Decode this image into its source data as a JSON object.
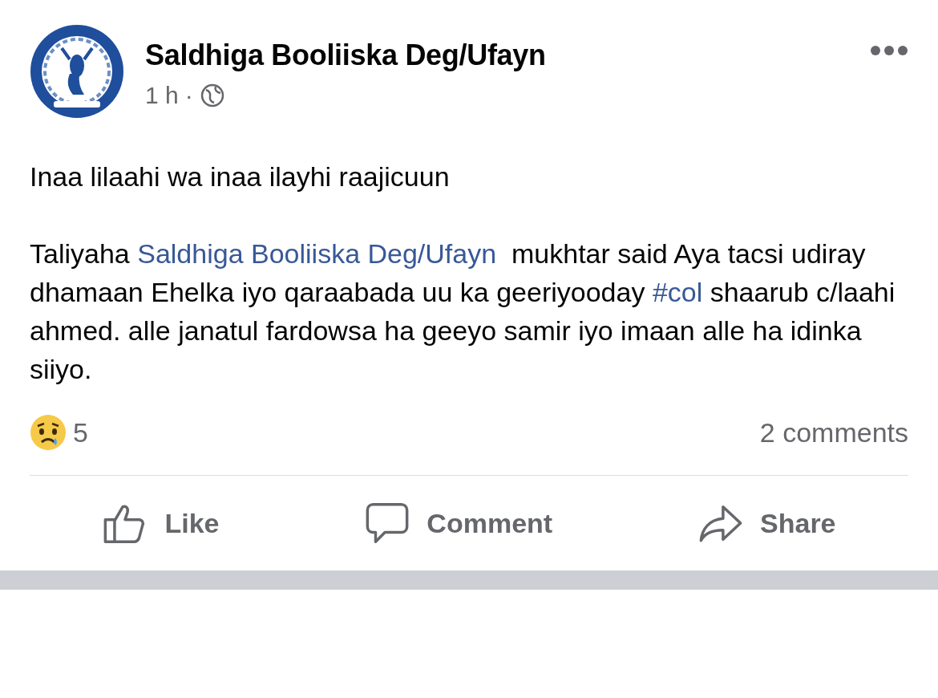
{
  "post": {
    "author": "Saldhiga Booliiska Deg/Ufayn",
    "time": "1 h",
    "separator": "·",
    "first_line": "Inaa lilaahi wa inaa ilayhi raajicuun",
    "body": [
      {
        "kind": "text",
        "text": "Taliyaha "
      },
      {
        "kind": "mention",
        "text": "Saldhiga Booliiska Deg/Ufayn"
      },
      {
        "kind": "text",
        "text": "  mukhtar said Aya tacsi udiray dhamaan Ehelka iyo qaraabada uu ka geeriyooday "
      },
      {
        "kind": "hashtag",
        "text": "#col"
      },
      {
        "kind": "text",
        "text": " shaarub c/laahi ahmed. alle janatul fardowsa ha geeyo samir iyo imaan alle ha idinka siiyo."
      }
    ],
    "reaction_count": "5",
    "comments": "2 comments"
  },
  "actions": [
    {
      "kind": "like",
      "label": "Like"
    },
    {
      "kind": "comment",
      "label": "Comment"
    },
    {
      "kind": "share",
      "label": "Share"
    }
  ]
}
